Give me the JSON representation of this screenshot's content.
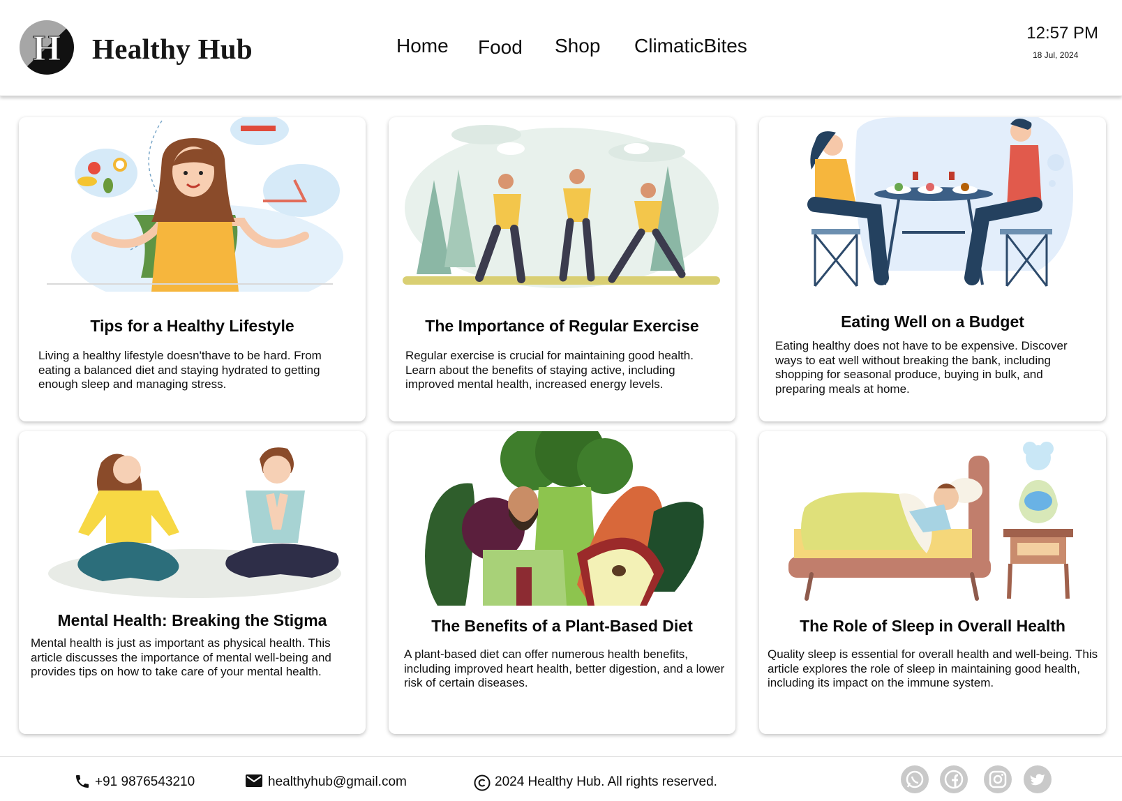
{
  "header": {
    "brand_name": "Healthy Hub",
    "logo_letter": "H",
    "nav": [
      "Home",
      "Food",
      "Shop",
      "ClimaticBites"
    ],
    "time": "12:57 PM",
    "date": "18 Jul, 2024"
  },
  "cards": [
    {
      "title": "Tips for a Healthy Lifestyle",
      "description": "Living a healthy lifestyle doesn'thave to be hard. From eating a balanced diet and staying hydrated to getting enough sleep and managing stress."
    },
    {
      "title": "The Importance of Regular Exercise",
      "description": "Regular exercise is crucial for maintaining good health. Learn about the benefits of staying active, including improved mental health, increased energy levels."
    },
    {
      "title": "Eating Well on a Budget",
      "description": "Eating healthy does not have to be expensive. Discover ways to eat well without breaking the bank, including shopping for seasonal produce, buying in bulk, and preparing meals at home."
    },
    {
      "title": "Mental Health: Breaking the Stigma",
      "description": "Mental health is just as important as physical health. This article discusses the importance of mental well-being and provides tips on how to take care of your mental health."
    },
    {
      "title": "The Benefits of a Plant-Based Diet",
      "description": "A plant-based diet can offer numerous health benefits, including improved heart health, better digestion, and a lower risk of certain diseases."
    },
    {
      "title": "The Role of Sleep in Overall Health",
      "description": "Quality sleep is essential for overall health and well-being. This article explores the role of sleep in maintaining good health, including its impact on the immune system."
    }
  ],
  "footer": {
    "phone": "+91 9876543210",
    "email": "healthyhub@gmail.com",
    "copyright": "2024 Healthy Hub. All rights reserved.",
    "social": [
      "whatsapp-icon",
      "facebook-icon",
      "instagram-icon",
      "twitter-icon"
    ]
  },
  "colors": {
    "brand_dark": "#111111",
    "card_shadow": "#bdbdbd",
    "social_grey": "#c9c9c9",
    "shirt_yellow": "#f6b63d",
    "trouser_navy": "#24415f"
  }
}
